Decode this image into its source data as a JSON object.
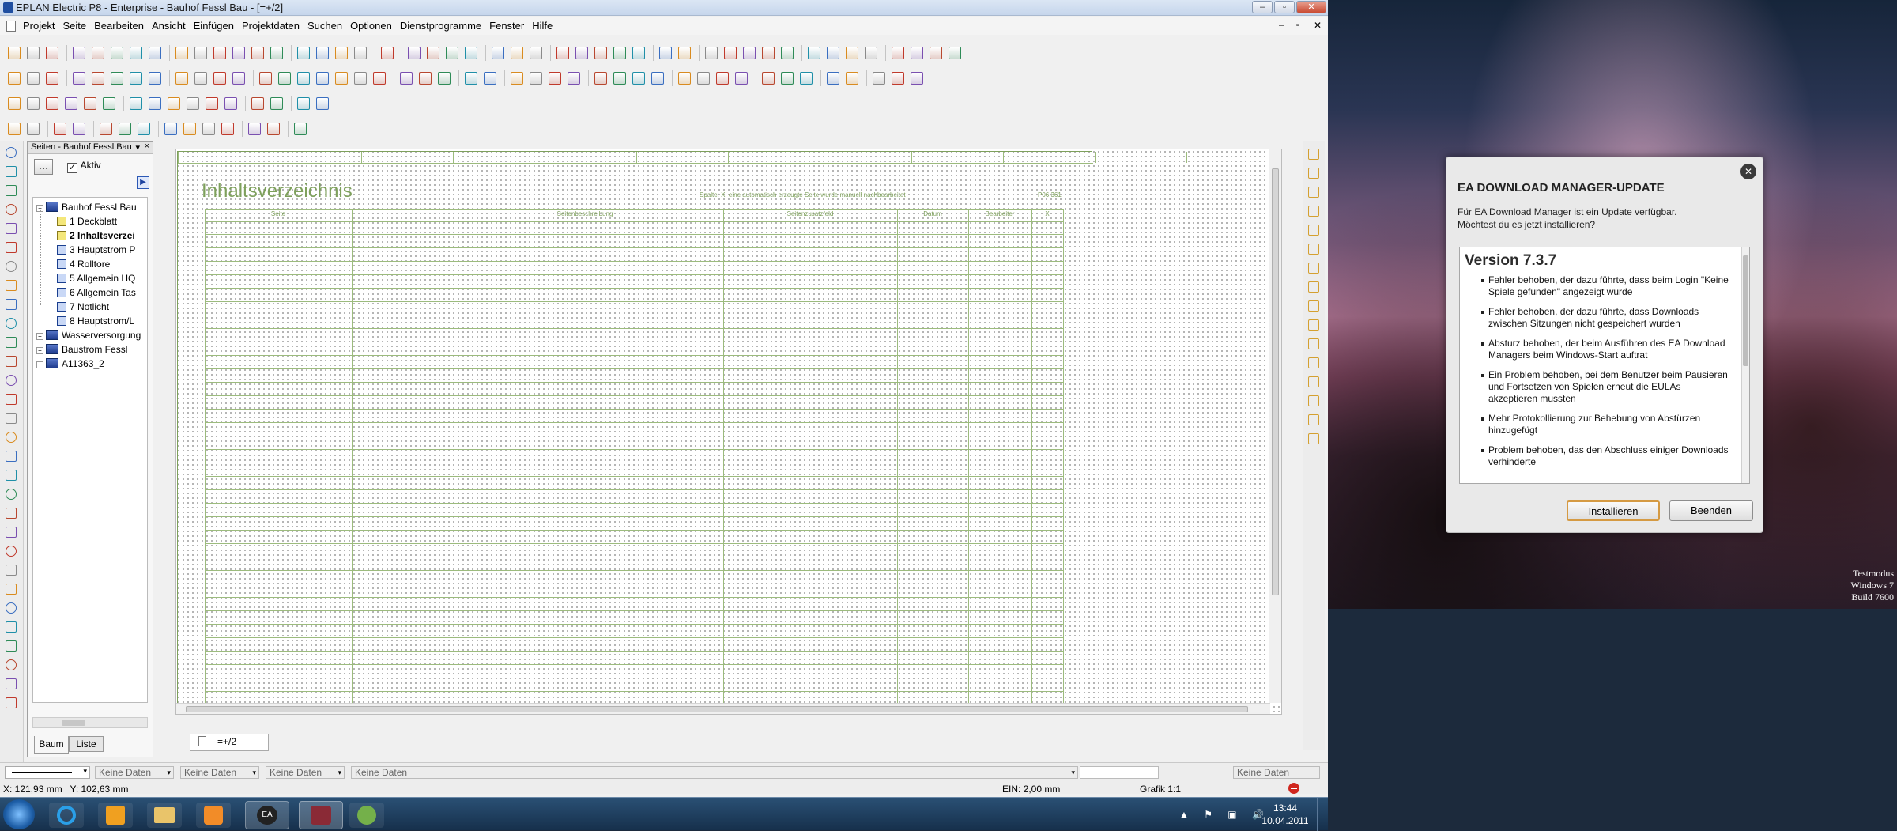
{
  "eplan": {
    "title": "EPLAN Electric P8 - Enterprise - Bauhof Fessl Bau - [=+/2]",
    "menu": [
      "Projekt",
      "Seite",
      "Bearbeiten",
      "Ansicht",
      "Einfügen",
      "Projektdaten",
      "Suchen",
      "Optionen",
      "Dienstprogramme",
      "Fenster",
      "Hilfe"
    ],
    "nav": {
      "header": "Seiten - Bauhof Fessl Bau",
      "aktiv_label": "Aktiv",
      "aktiv_checked": true,
      "tree": [
        {
          "label": "Bauhof Fessl Bau",
          "type": "project",
          "expanded": true
        },
        {
          "label": "1 Deckblatt",
          "type": "page-yellow"
        },
        {
          "label": "2 Inhaltsverzei",
          "type": "page-yellow",
          "selected": true
        },
        {
          "label": "3 Hauptstrom P",
          "type": "page"
        },
        {
          "label": "4 Rolltore",
          "type": "page"
        },
        {
          "label": "5 Allgemein HQ",
          "type": "page"
        },
        {
          "label": "6 Allgemein Tas",
          "type": "page"
        },
        {
          "label": "7 Notlicht",
          "type": "page"
        },
        {
          "label": "8 Hauptstrom/L",
          "type": "page"
        },
        {
          "label": "Wasserversorgung",
          "type": "project",
          "expanded": false
        },
        {
          "label": "Baustrom Fessl",
          "type": "project",
          "expanded": false
        },
        {
          "label": "A11363_2",
          "type": "project",
          "expanded": false
        }
      ],
      "tabs": [
        "Baum",
        "Liste"
      ]
    },
    "sheet": {
      "title": "Inhaltsverzeichnis",
      "note": "Spalte: X: eine automatisch erzeugte Seite wurde manuell nachbearbeitet",
      "page_ref": "P06 361",
      "columns": [
        "Seite",
        "Seitenbeschreibung",
        "Seitenzusatzfeld",
        "Datum",
        "Bearbeiter",
        "X"
      ]
    },
    "doc_tab": "=+/2",
    "status": {
      "combo1": "Keine Daten",
      "combo2": "Keine Daten",
      "combo3": "Keine Daten",
      "combo4": "Keine Daten",
      "combo5": "Keine Daten",
      "coords": "X: 121,93 mm   Y: 102,63 mm",
      "ein": "EIN: 2,00 mm",
      "grafik": "Grafik 1:1"
    }
  },
  "taskbar": {
    "time": "13:44",
    "date": "10.04.2011"
  },
  "desktop": {
    "testmodus": "Testmodus",
    "os": "Windows 7",
    "build": "Build 7600"
  },
  "dialog": {
    "title": "EA DOWNLOAD MANAGER-UPDATE",
    "line1": "Für EA Download Manager ist ein Update verfügbar.",
    "line2": "Möchtest du es jetzt installieren?",
    "version": "Version 7.3.7",
    "notes": [
      "Fehler behoben, der dazu führte, dass beim Login \"Keine Spiele gefunden\" angezeigt wurde",
      "Fehler behoben, der dazu führte, dass Downloads zwischen Sitzungen nicht gespeichert wurden",
      "Absturz behoben, der beim Ausführen des EA Download Managers beim Windows-Start auftrat",
      "Ein Problem behoben, bei dem Benutzer beim Pausieren und Fortsetzen von Spielen erneut die EULAs akzeptieren mussten",
      "Mehr Protokollierung zur Behebung von Abstürzen hinzugefügt",
      "Problem behoben, das den Abschluss einiger Downloads verhinderte"
    ],
    "install": "Installieren",
    "quit": "Beenden"
  }
}
